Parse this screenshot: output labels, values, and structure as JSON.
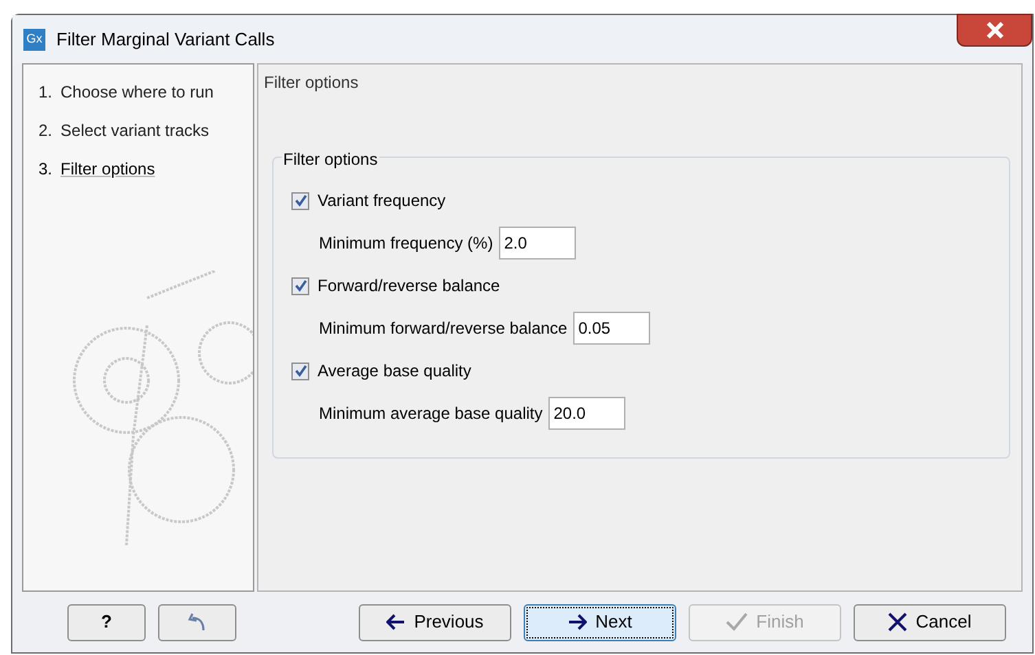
{
  "window": {
    "title": "Filter Marginal Variant Calls",
    "app_icon": "Gx"
  },
  "steps": [
    {
      "number": "1.",
      "label": "Choose where to run",
      "selected": false
    },
    {
      "number": "2.",
      "label": "Select variant tracks",
      "selected": false
    },
    {
      "number": "3.",
      "label": "Filter options",
      "selected": true
    }
  ],
  "panel": {
    "title": "Filter options",
    "group_title": "Filter options",
    "options": [
      {
        "checkbox": {
          "label": "Variant frequency",
          "checked": true
        },
        "field": {
          "label": "Minimum frequency (%)",
          "value": "2.0"
        }
      },
      {
        "checkbox": {
          "label": "Forward/reverse balance",
          "checked": true
        },
        "field": {
          "label": "Minimum forward/reverse balance",
          "value": "0.05"
        }
      },
      {
        "checkbox": {
          "label": "Average base quality",
          "checked": true
        },
        "field": {
          "label": "Minimum average base quality",
          "value": "20.0"
        }
      }
    ]
  },
  "buttons": [
    {
      "kind": "help",
      "label": "?",
      "disabled": false,
      "focused": false
    },
    {
      "kind": "reset",
      "disabled": false,
      "focused": false
    },
    {
      "kind": "previous",
      "label": "Previous",
      "disabled": false,
      "focused": false
    },
    {
      "kind": "next",
      "label": "Next",
      "disabled": false,
      "focused": true
    },
    {
      "kind": "finish",
      "label": "Finish",
      "disabled": true,
      "focused": false
    },
    {
      "kind": "cancel",
      "label": "Cancel",
      "disabled": false,
      "focused": false
    }
  ]
}
